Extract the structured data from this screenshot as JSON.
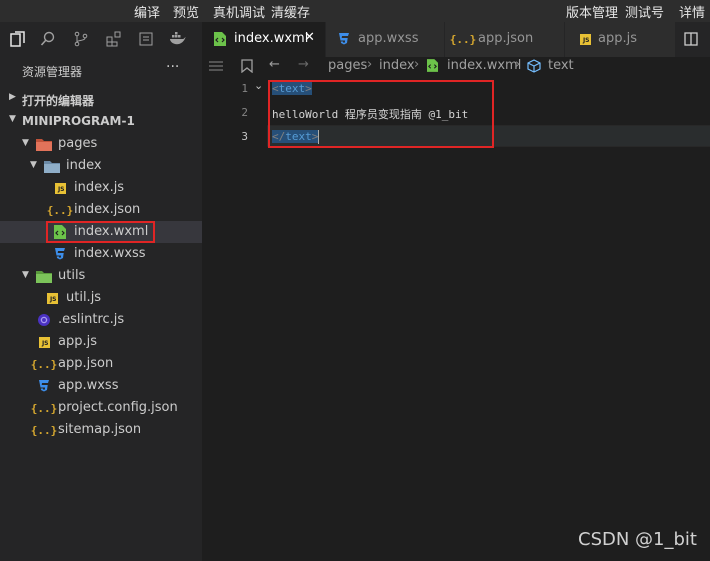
{
  "menubar": {
    "left": [
      "编译",
      "预览",
      "真机调试",
      "清缓存"
    ],
    "right": [
      "版本管理",
      "测试号",
      "详情"
    ]
  },
  "sidebar": {
    "title": "资源管理器",
    "more": "···",
    "sections": [
      "打开的编辑器",
      "MINIPROGRAM-1"
    ],
    "tree": [
      {
        "name": "pages",
        "icon": "folder-icon",
        "expanded": true
      },
      {
        "name": "index",
        "icon": "folder-icon",
        "expanded": true
      },
      {
        "name": "index.js",
        "icon": "js-file-icon"
      },
      {
        "name": "index.json",
        "icon": "json-file-icon"
      },
      {
        "name": "index.wxml",
        "icon": "wxml-file-icon",
        "selected": true
      },
      {
        "name": "index.wxss",
        "icon": "css-file-icon"
      },
      {
        "name": "utils",
        "icon": "folder-icon",
        "expanded": true
      },
      {
        "name": "util.js",
        "icon": "js-file-icon"
      },
      {
        "name": ".eslintrc.js",
        "icon": "eslint-file-icon"
      },
      {
        "name": "app.js",
        "icon": "js-file-icon"
      },
      {
        "name": "app.json",
        "icon": "json-file-icon"
      },
      {
        "name": "app.wxss",
        "icon": "css-file-icon"
      },
      {
        "name": "project.config.json",
        "icon": "json-file-icon"
      },
      {
        "name": "sitemap.json",
        "icon": "json-file-icon"
      }
    ]
  },
  "tabs": [
    {
      "name": "index.wxml",
      "icon": "wxml-file-icon",
      "active": true,
      "close": "✕"
    },
    {
      "name": "app.wxss",
      "icon": "css-file-icon"
    },
    {
      "name": "app.json",
      "icon": "json-file-icon"
    },
    {
      "name": "app.js",
      "icon": "js-file-icon"
    }
  ],
  "breadcrumb": [
    "pages",
    "index",
    "index.wxml",
    "text"
  ],
  "editor": {
    "line_numbers": [
      "1",
      "2",
      "3"
    ],
    "line1_tag": "text",
    "line2_text": "helloWorld 程序员变现指南 @1_bit",
    "line3_tag": "text",
    "current_line": 3
  },
  "colors": {
    "tag": "#569cd6",
    "bracket": "#808080",
    "highlight_border": "#e02525",
    "js_badge": "#e8c135",
    "css_icon": "#3d8eea",
    "wxml_icon": "#6cc24a",
    "json_icon": "#d7a82f",
    "folder_icon": "#8faec8"
  },
  "watermark": "CSDN @1_bit"
}
